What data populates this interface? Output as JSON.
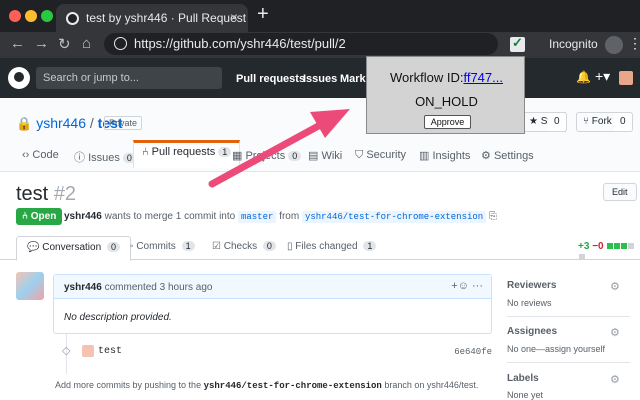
{
  "browser": {
    "tab_title": "test by yshr446 · Pull Request",
    "url": "https://github.com/yshr446/test/pull/2",
    "incognito_label": "Incognito",
    "window_dots": [
      "#ff5f57",
      "#febc2e",
      "#28c840"
    ]
  },
  "github": {
    "search_placeholder": "Search or jump to...",
    "nav": [
      "Pull requests",
      "Issues",
      "Marke"
    ]
  },
  "repo": {
    "owner": "yshr446",
    "sep": " / ",
    "name": "test",
    "visibility": "Private",
    "star_label": "Star",
    "star_count": "0",
    "fork_label": "Fork",
    "fork_count": "0",
    "tabs": [
      {
        "label": "Code",
        "count": ""
      },
      {
        "label": "Issues",
        "count": "0"
      },
      {
        "label": "Pull requests",
        "count": "1"
      },
      {
        "label": "Projects",
        "count": "0"
      },
      {
        "label": "Wiki",
        "count": ""
      },
      {
        "label": "Security",
        "count": ""
      },
      {
        "label": "Insights",
        "count": ""
      },
      {
        "label": "Settings",
        "count": ""
      }
    ]
  },
  "pr": {
    "title": "test",
    "number": "#2",
    "edit_label": "Edit",
    "state": "Open",
    "author": "yshr446",
    "merge_text": "wants to merge 1 commit into",
    "base_branch": "master",
    "from_text": "from",
    "head_branch": "yshr446/test-for-chrome-extension",
    "tabs": [
      {
        "label": "Conversation",
        "count": "0"
      },
      {
        "label": "Commits",
        "count": "1"
      },
      {
        "label": "Checks",
        "count": "0"
      },
      {
        "label": "Files changed",
        "count": "1"
      }
    ],
    "additions": "+3",
    "deletions": "−0",
    "diffstat_colors": [
      "#2cbe4e",
      "#2cbe4e",
      "#2cbe4e",
      "#d1d5da",
      "#d1d5da"
    ]
  },
  "comment": {
    "author": "yshr446",
    "action": "commented 3 hours ago",
    "body": "No description provided."
  },
  "commit": {
    "message": "test",
    "sha": "6e640fe"
  },
  "hint": {
    "prefix": "Add more commits by pushing to the",
    "branch": "yshr446/test-for-chrome-extension",
    "middle": "branch on",
    "repo": "yshr446/test",
    "suffix": "."
  },
  "sidebar": {
    "reviewers_label": "Reviewers",
    "reviewers_value": "No reviews",
    "assignees_label": "Assignees",
    "assignees_value": "No one—assign yourself",
    "labels_label": "Labels",
    "labels_value": "None yet"
  },
  "popup": {
    "workflow_label": "Workflow ID:",
    "workflow_id": "ff747...",
    "status": "ON_HOLD",
    "approve_label": "Approve"
  },
  "colors": {
    "arrow": "#ec4b7a",
    "open_badge": "#28a745",
    "link": "#0366d6"
  }
}
